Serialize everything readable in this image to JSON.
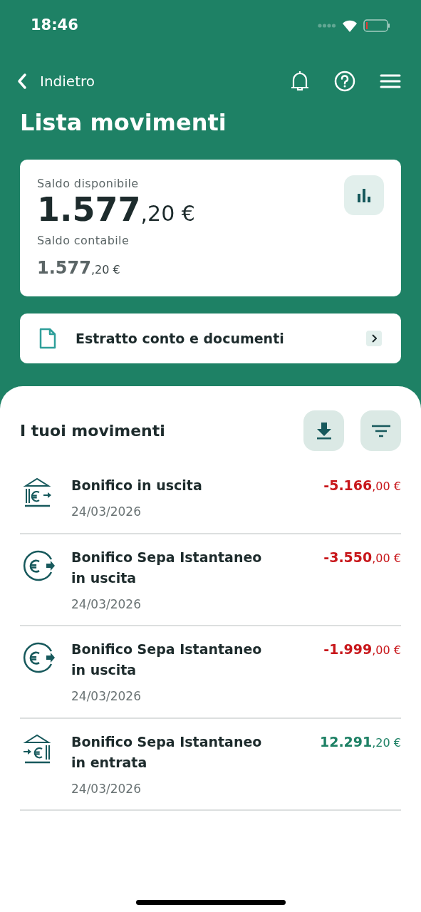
{
  "status_bar": {
    "time": "18:46"
  },
  "nav": {
    "back_label": "Indietro"
  },
  "title": "Lista movimenti",
  "balance_card": {
    "available_label": "Saldo disponibile",
    "available_amount": "**1.577**,20 €",
    "accounting_label": "Saldo contabile",
    "accounting_amount": "**1.577**,20 €"
  },
  "documents_link": {
    "label": "Estratto conto e documenti"
  },
  "movements": {
    "title": "I tuoi movimenti",
    "items": [
      {
        "kind": "bank-out",
        "color": "#c8171b",
        "title": "Bonifico in uscita",
        "date": "24/03/2026",
        "amount": "**-5.166**,00 €"
      },
      {
        "kind": "euro-out",
        "color": "#c8171b",
        "title": "Bonifico Sepa Istantaneo in uscita",
        "date": "24/03/2026",
        "amount": "**-3.550**,00 €"
      },
      {
        "kind": "euro-out",
        "color": "#c8171b",
        "title": "Bonifico Sepa Istantaneo in uscita",
        "date": "24/03/2026",
        "amount": "**-1.999**,00 €"
      },
      {
        "kind": "bank-in",
        "color": "#1e8165",
        "title": "Bonifico Sepa Istantaneo in entrata",
        "date": "24/03/2026",
        "amount": "**12.291**,20 €"
      }
    ]
  }
}
